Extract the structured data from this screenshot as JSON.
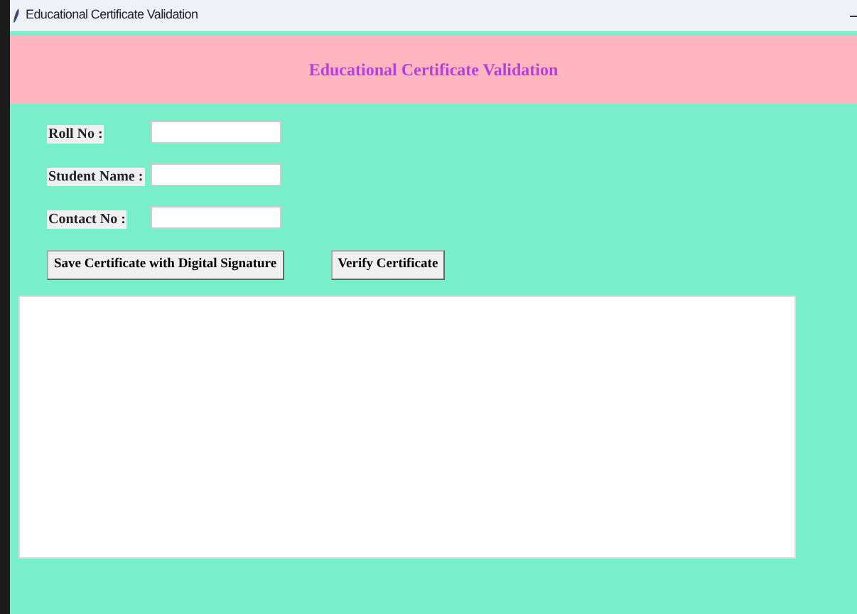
{
  "window": {
    "title": "Educational Certificate Validation"
  },
  "header": {
    "title": "Educational Certificate Validation"
  },
  "form": {
    "fields": [
      {
        "label": "Roll No :"
      },
      {
        "label": "Student Name :"
      },
      {
        "label": "Contact No :"
      }
    ]
  },
  "buttons": [
    "Save Certificate with Digital Signature",
    "Verify Certificate"
  ],
  "output": {
    "kind": "text-area"
  }
}
